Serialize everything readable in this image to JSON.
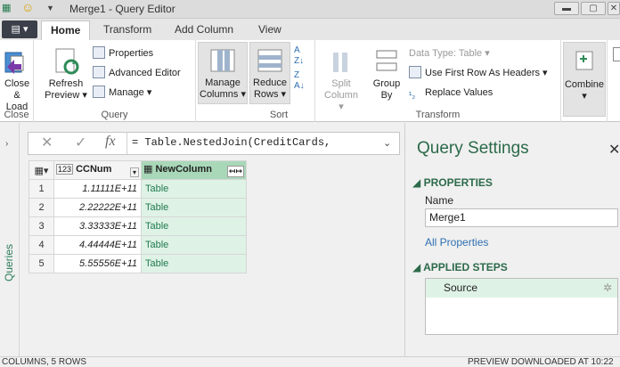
{
  "window": {
    "title": "Merge1 - Query Editor",
    "qa_icons": [
      "excel-icon",
      "smiley-icon",
      "dropdown-icon"
    ],
    "buttons": [
      "minimize",
      "maximize",
      "close"
    ]
  },
  "tabs": {
    "file": "",
    "items": [
      "Home",
      "Transform",
      "Add Column",
      "View"
    ],
    "active": "Home"
  },
  "ribbon": {
    "close_group": {
      "button": "Close & Load",
      "btn_line1": "Close &",
      "btn_line2": "Load",
      "label": "Close"
    },
    "query_group": {
      "refresh_line1": "Refresh",
      "refresh_line2": "Preview",
      "properties": "Properties",
      "advanced_editor": "Advanced Editor",
      "manage": "Manage",
      "label": "Query"
    },
    "sort_group": {
      "manage_columns_line1": "Manage",
      "manage_columns_line2": "Columns",
      "reduce_rows_line1": "Reduce",
      "reduce_rows_line2": "Rows",
      "label": "Sort"
    },
    "transform_group": {
      "split_column_line1": "Split",
      "split_column_line2": "Column",
      "group_by_line1": "Group",
      "group_by_line2": "By",
      "data_type": "Data Type: Table",
      "use_first_row": "Use First Row As Headers",
      "replace_values": "Replace Values",
      "label": "Transform"
    },
    "combine_group": {
      "button": "Combine"
    }
  },
  "formula": {
    "text": "= Table.NestedJoin(CreditCards,"
  },
  "query_strip": {
    "label": "Queries"
  },
  "grid": {
    "columns": [
      {
        "type_icon": "123",
        "name": "CCNum"
      },
      {
        "type_icon": "table",
        "name": "NewColumn"
      }
    ],
    "rows": [
      {
        "num": "1",
        "ccnum": "1.11111E+11",
        "newcol": "Table"
      },
      {
        "num": "2",
        "ccnum": "2.22222E+11",
        "newcol": "Table"
      },
      {
        "num": "3",
        "ccnum": "3.33333E+11",
        "newcol": "Table"
      },
      {
        "num": "4",
        "ccnum": "4.44444E+11",
        "newcol": "Table"
      },
      {
        "num": "5",
        "ccnum": "5.55556E+11",
        "newcol": "Table"
      }
    ]
  },
  "settings": {
    "title": "Query Settings",
    "properties_header": "PROPERTIES",
    "name_label": "Name",
    "name_value": "Merge1",
    "all_properties": "All Properties",
    "applied_steps_header": "APPLIED STEPS",
    "steps": [
      "Source"
    ]
  },
  "status": {
    "left": "COLUMNS, 5 ROWS",
    "right": "PREVIEW DOWNLOADED AT 10:22"
  },
  "colors": {
    "accent_green": "#2c6a4a",
    "table_cell_bg": "#dff2e6",
    "link_blue": "#2f6fb0"
  }
}
